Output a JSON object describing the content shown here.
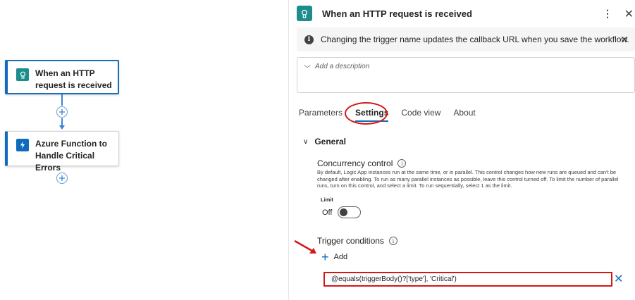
{
  "canvas": {
    "nodes": [
      {
        "title": "When an HTTP request is received",
        "line1": "When an HTTP",
        "line2": "request is received",
        "icon": "http-request-icon",
        "color": "#1c8c8c"
      },
      {
        "title": "Azure Function to Handle Critical Errors",
        "line1": "Azure Function to",
        "line2": "Handle Critical Errors",
        "icon": "azure-function-icon",
        "color": "#0f6cbd"
      }
    ]
  },
  "panel": {
    "title": "When an HTTP request is received",
    "banner": "Changing the trigger name updates the callback URL when you save the workflow.",
    "description_placeholder": "Add a description",
    "tabs": [
      {
        "label": "Parameters"
      },
      {
        "label": "Settings",
        "active": true
      },
      {
        "label": "Code view"
      },
      {
        "label": "About"
      }
    ],
    "section_title": "General",
    "concurrency": {
      "label": "Concurrency control",
      "help": "By default, Logic App instances run at the same time, or in parallel. This control changes how new runs are queued and can't be changed after enabling. To run as many parallel instances as possible, leave this control turned off. To limit the number of parallel runs, turn on this control, and select a limit. To run sequentially, select 1 as the limit.",
      "limit_label": "Limit",
      "toggle_state": "Off"
    },
    "trigger_conditions": {
      "label": "Trigger conditions",
      "add_label": "Add",
      "value": "@equals(triggerBody()?['type'], 'Critical')"
    }
  },
  "colors": {
    "accent": "#0f6cbd",
    "annotation": "#d41818",
    "trigger_icon": "#1c8c8c"
  }
}
